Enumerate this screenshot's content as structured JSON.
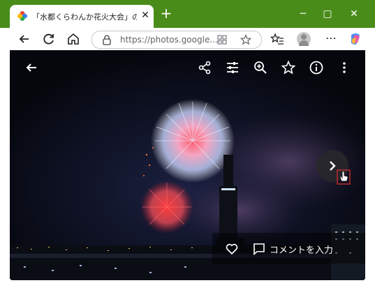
{
  "browser": {
    "tab_title": "「水都くらわんか花火大会」の写真 - Google フォト",
    "address": "https://photos.google....",
    "accent": "#4a8c1a"
  },
  "viewer": {
    "comment_label": "コメントを入力"
  },
  "icons": [
    "back-icon",
    "share-icon",
    "edit-icon",
    "zoom-icon",
    "star-icon",
    "info-icon",
    "more-icon",
    "next-icon",
    "heart-icon",
    "comment-icon"
  ]
}
